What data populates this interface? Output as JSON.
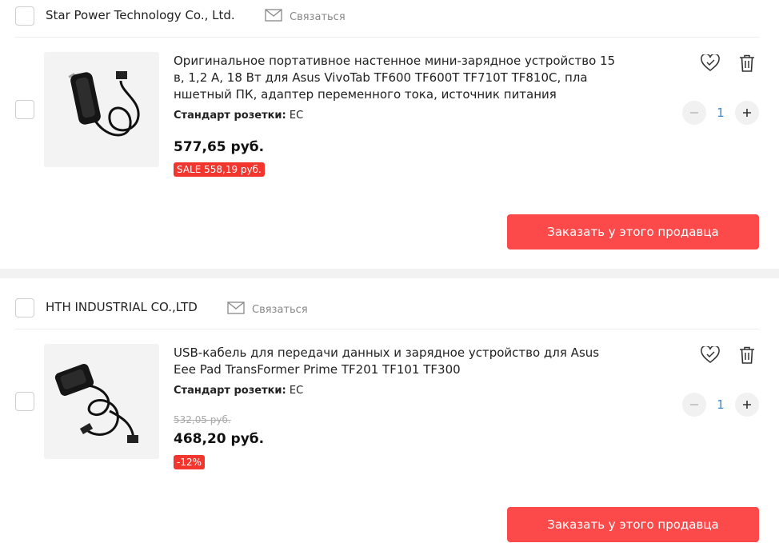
{
  "sellers": [
    {
      "name": "Star Power Technology Co., Ltd.",
      "contact_label": "Связаться",
      "item": {
        "title": "Оригинальное портативное настенное мини-зарядное устройство 15 в, 1,2 А, 18 Вт для Asus VivoTab TF600 TF600T TF710T TF810C, пла ншетный ПК, адаптер переменного тока, источник питания",
        "spec_label": "Стандарт розетки:",
        "spec_value": "EC",
        "price": "577,65 руб.",
        "badge": "SALE 558,19 руб.",
        "quantity": "1"
      },
      "order_label": "Заказать у этого продавца"
    },
    {
      "name": "HTH INDUSTRIAL CO.,LTD",
      "contact_label": "Связаться",
      "item": {
        "title": "USB-кабель для передачи данных и зарядное устройство для Asus Eee Pad TransFormer Prime TF201 TF101 TF300",
        "spec_label": "Стандарт розетки:",
        "spec_value": "EC",
        "old_price": "532,05 руб.",
        "price": "468,20 руб.",
        "badge": "-12%",
        "quantity": "1"
      },
      "order_label": "Заказать у этого продавца"
    }
  ],
  "colors": {
    "accent": "#fc4949",
    "badge": "#f2352d",
    "qty": "#3a8bd4",
    "separator": "#f2f2f2"
  },
  "icons": [
    "mail-icon",
    "wishlist-heart-icon",
    "trash-icon",
    "minus-icon",
    "plus-icon",
    "checkbox"
  ]
}
